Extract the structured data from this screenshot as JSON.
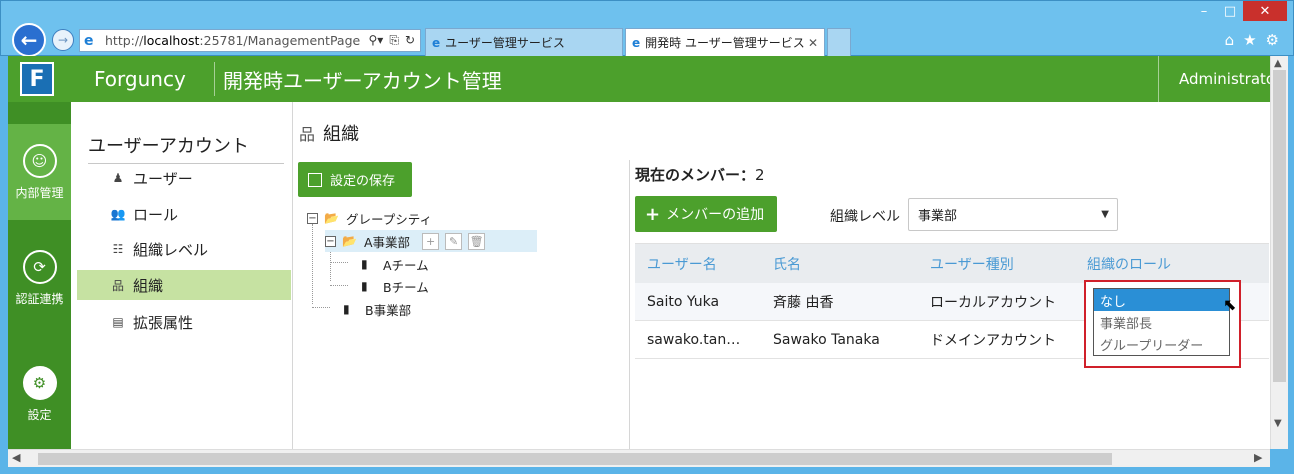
{
  "browser": {
    "url_prefix": "http://",
    "url_host": "localhost",
    "url_rest": ":25781/ManagementPage",
    "tabs": [
      {
        "label": "ユーザー管理サービス"
      },
      {
        "label": "開発時 ユーザー管理サービス"
      }
    ]
  },
  "header": {
    "logo_letter": "F",
    "brand": "Forguncy",
    "title": "開発時ユーザーアカウント管理",
    "user": "Administrator"
  },
  "leftnav": [
    {
      "label": "内部管理"
    },
    {
      "label": "認証連携"
    },
    {
      "label": "設定"
    }
  ],
  "subnav": {
    "title": "ユーザーアカウント",
    "items": [
      {
        "label": "ユーザー"
      },
      {
        "label": "ロール"
      },
      {
        "label": "組織レベル"
      },
      {
        "label": "組織"
      },
      {
        "label": "拡張属性"
      }
    ]
  },
  "content": {
    "title": "組織",
    "save_label": "設定の保存",
    "tree": {
      "root": "グレープシティ",
      "a_dept": "A事業部",
      "a_team": "Aチーム",
      "b_team": "Bチーム",
      "b_dept": "B事業部"
    },
    "members_label": "現在のメンバー：",
    "members_count": "2",
    "add_member_label": "メンバーの追加",
    "level_label": "組織レベル",
    "level_value": "事業部",
    "table": {
      "headers": [
        "ユーザー名",
        "氏名",
        "ユーザー種別",
        "組織のロール"
      ],
      "rows": [
        {
          "username": "Saito Yuka",
          "name": "斉藤 由香",
          "type": "ローカルアカウント"
        },
        {
          "username": "sawako.tan…",
          "name": "Sawako Tanaka",
          "type": "ドメインアカウント"
        }
      ]
    },
    "role_options": [
      "なし",
      "事業部長",
      "グループリーダー"
    ]
  },
  "colors": {
    "brand_green": "#4ca02c",
    "nav_green": "#3f8f25",
    "highlight_red": "#d0202a",
    "selection_blue": "#2a8fd6"
  }
}
